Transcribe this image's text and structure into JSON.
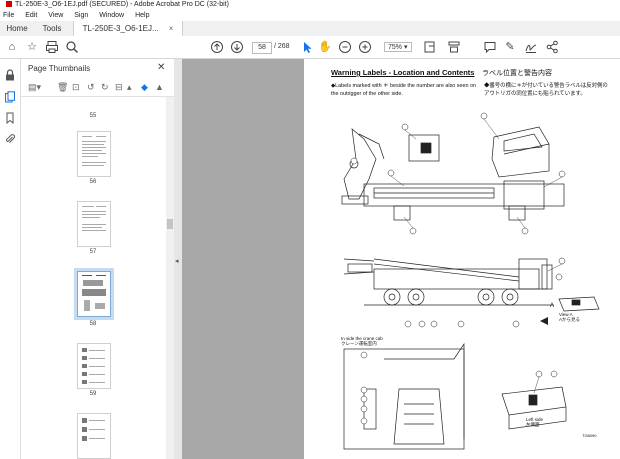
{
  "window": {
    "title": "TL-250E-3_O6-1EJ.pdf (SECURED) - Adobe Acrobat Pro DC (32-bit)"
  },
  "menu": [
    "File",
    "Edit",
    "View",
    "Sign",
    "Window",
    "Help"
  ],
  "tabs": {
    "home": "Home",
    "tools": "Tools",
    "document": "TL-250E-3_O6-1EJ..."
  },
  "toolbar": {
    "page_current": "58",
    "page_total": "/ 268",
    "zoom": "75%"
  },
  "panel": {
    "title": "Page Thumbnails",
    "thumbnails": [
      {
        "label": "55"
      },
      {
        "label": "56"
      },
      {
        "label": "57"
      },
      {
        "label": "58",
        "selected": true
      },
      {
        "label": "59"
      },
      {
        "label": ""
      }
    ]
  },
  "document": {
    "heading_en": "Warning Labels - Location and Contents",
    "heading_jp": "ラベル位置と警告内容",
    "note_en": "◆Labels marked with ＊ beside the number are also seen on the outrigger of the other side.",
    "note_jp": "◆番号の横に＊が付いている警告ラベルは反対側のアウトリガの同位置にも貼られています。",
    "view_label_en": "View A",
    "view_label_jp": "Aから見る",
    "cab_label_en": "In side the crane cab",
    "cab_label_jp": "クレーン運転室内",
    "left_label_en": "Left side",
    "left_label_jp": "左側面",
    "marker_a": "A",
    "figure_code": "TG8090"
  },
  "icons": {
    "title": "pdf-app-icon",
    "home": "home-icon",
    "star": "bookmark-star-icon",
    "print": "print-icon",
    "zoom": "search-zoom-icon",
    "up": "previous-page-icon",
    "down": "next-page-icon",
    "cursor": "select-cursor-icon",
    "hand": "hand-tool-icon",
    "zoomout": "zoom-out-icon",
    "zoomin": "zoom-in-icon",
    "fit": "fit-page-icon",
    "scroll": "scroll-mode-icon",
    "comment": "comment-icon",
    "pen": "pen-icon",
    "sign": "sign-icon",
    "share": "share-icon",
    "lock": "lock-icon",
    "thumbs": "page-thumbnails-icon",
    "bookmarks": "bookmarks-icon",
    "attach": "attachments-icon",
    "close": "close-icon"
  },
  "colors": {
    "accent": "#1473e6",
    "viewer_bg": "#a8a8a8"
  }
}
